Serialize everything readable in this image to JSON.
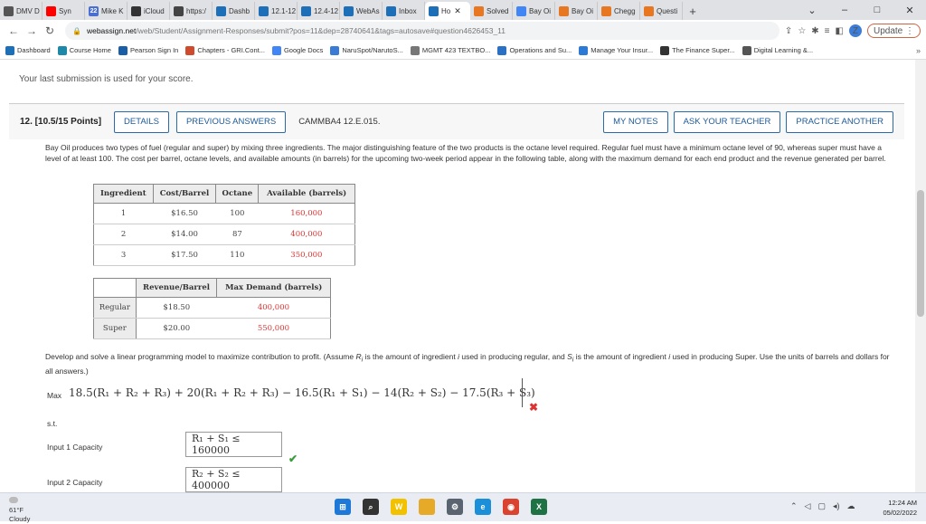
{
  "browser": {
    "tabs": [
      {
        "label": "DMV D",
        "icon": "chrome-icon",
        "color": "#555555"
      },
      {
        "label": "Syn",
        "icon": "youtube-icon",
        "color": "#ff0000"
      },
      {
        "label": "Mike K",
        "icon": "twenty-two-icon",
        "color": "#4a6fd1",
        "icon_text": "22"
      },
      {
        "label": "iCloud",
        "icon": "apple-icon",
        "color": "#333333"
      },
      {
        "label": "https:/",
        "icon": "doc-icon",
        "color": "#444444"
      },
      {
        "label": "Dashb",
        "icon": "webassign-icon",
        "color": "#1d6fb8"
      },
      {
        "label": "12.1-12",
        "icon": "webassign-icon",
        "color": "#1d6fb8"
      },
      {
        "label": "12.4-12",
        "icon": "webassign-icon",
        "color": "#1d6fb8"
      },
      {
        "label": "WebAs",
        "icon": "webassign-icon",
        "color": "#1d6fb8"
      },
      {
        "label": "Inbox",
        "icon": "webassign-icon",
        "color": "#1d6fb8"
      },
      {
        "label": "Ho",
        "icon": "webassign-icon",
        "color": "#1d6fb8",
        "active": true
      },
      {
        "label": "Solved",
        "icon": "chegg-icon",
        "color": "#e87722"
      },
      {
        "label": "Bay Oi",
        "icon": "google-icon",
        "color": "#4285f4"
      },
      {
        "label": "Bay Oi",
        "icon": "chegg-icon",
        "color": "#e87722"
      },
      {
        "label": "Chegg",
        "icon": "chegg-icon",
        "color": "#e87722"
      },
      {
        "label": "Questi",
        "icon": "chegg-icon",
        "color": "#e87722"
      }
    ],
    "new_tab": "+",
    "window_controls": {
      "minimize": "–",
      "maximize": "□",
      "close": "✕"
    },
    "url_host": "webassign.net",
    "url_path": "/web/Student/Assignment-Responses/submit?pos=11&dep=28740641&tags=autosave#question4626453_11",
    "avatar_letter": "Z",
    "update_label": "Update",
    "bookmarks": [
      {
        "label": "Dashboard",
        "icon": "webassign-icon",
        "color": "#1d6fb8"
      },
      {
        "label": "Course Home",
        "icon": "course-icon",
        "color": "#1e88a8"
      },
      {
        "label": "Pearson Sign In",
        "icon": "pearson-icon",
        "color": "#1a5ea8"
      },
      {
        "label": "Chapters - GRI.Cont...",
        "icon": "chapters-icon",
        "color": "#d04a2e"
      },
      {
        "label": "Google Docs",
        "icon": "docs-icon",
        "color": "#4285f4"
      },
      {
        "label": "NaruSpot/NarutoS...",
        "icon": "naru-icon",
        "color": "#3a7bd5"
      },
      {
        "label": "MGMT 423 TEXTBO...",
        "icon": "globe-icon",
        "color": "#777777"
      },
      {
        "label": "Operations and Su...",
        "icon": "book-icon",
        "color": "#2a70c4"
      },
      {
        "label": "Manage Your Insur...",
        "icon": "insurance-icon",
        "color": "#2c7ad6"
      },
      {
        "label": "The Finance Super...",
        "icon": "finance-icon",
        "color": "#333333"
      },
      {
        "label": "Digital Learning &...",
        "icon": "learning-icon",
        "color": "#555555"
      }
    ]
  },
  "page": {
    "submission_note": "Your last submission is used for your score.",
    "question_number": "12.  [10.5/15 Points]",
    "details_button": "DETAILS",
    "previous_answers_button": "PREVIOUS ANSWERS",
    "question_code": "CAMMBA4 12.E.015.",
    "my_notes_button": "MY NOTES",
    "ask_teacher_button": "ASK YOUR TEACHER",
    "practice_button": "PRACTICE ANOTHER",
    "problem_text": "Bay Oil produces two types of fuel (regular and super) by mixing three ingredients. The major distinguishing feature of the two products is the octane level required. Regular fuel must have a minimum octane level of 90, whereas super must have a level of at least 100. The cost per barrel, octane levels, and available amounts (in barrels) for the upcoming two-week period appear in the following table, along with the maximum demand for each end product and the revenue generated per barrel.",
    "ingredient_table": {
      "headers": [
        "Ingredient",
        "Cost/Barrel",
        "Octane",
        "Available (barrels)"
      ],
      "rows": [
        [
          "1",
          "$16.50",
          "100",
          "160,000"
        ],
        [
          "2",
          "$14.00",
          "87",
          "400,000"
        ],
        [
          "3",
          "$17.50",
          "110",
          "350,000"
        ]
      ]
    },
    "product_table": {
      "headers": [
        "",
        "Revenue/Barrel",
        "Max Demand (barrels)"
      ],
      "rows": [
        [
          "Regular",
          "$18.50",
          "400,000"
        ],
        [
          "Super",
          "$20.00",
          "550,000"
        ]
      ]
    },
    "instructions_a": "Develop and solve a linear programming model to maximize contribution to profit. (Assume ",
    "instructions_b": " is the amount of ingredient ",
    "instructions_c": " used in producing regular, and ",
    "instructions_d": " is the amount of ingredient ",
    "instructions_e": " used in producing Super. Use the units of barrels and dollars for all answers.)",
    "sym_R": "R",
    "sym_S": "S",
    "sym_i": "i",
    "sym_i2": "i",
    "max_label": "Max",
    "objective_expression": "18.5(R₁ + R₂ + R₃) + 20(R₁ + R₂ + R₃) − 16.5(R₁ + S₁) − 14(R₂ + S₂) − 17.5(R₃ + S₃)",
    "objective_wrong_mark": "✖",
    "st_label": "s.t.",
    "constraints": [
      {
        "label": "Input 1 Capacity",
        "expression": "R₁ + S₁ ≤ 160000",
        "mark": "✔"
      },
      {
        "label": "Input 2 Capacity",
        "expression": "R₂ + S₂ ≤ 400000",
        "mark": ""
      }
    ]
  },
  "taskbar": {
    "temperature": "61°F",
    "condition": "Cloudy",
    "apps": [
      {
        "name": "windows-start-icon",
        "color": "#1e78d7",
        "text": "⊞"
      },
      {
        "name": "search-icon",
        "color": "#333333",
        "text": "⌕"
      },
      {
        "name": "norton-icon",
        "color": "#f2c100",
        "text": "W"
      },
      {
        "name": "folder-icon",
        "color": "#e7a928",
        "text": ""
      },
      {
        "name": "settings-icon",
        "color": "#5a6470",
        "text": "⚙"
      },
      {
        "name": "edge-icon",
        "color": "#1b8fd8",
        "text": "e"
      },
      {
        "name": "chrome-icon",
        "color": "#d9432f",
        "text": "◉"
      },
      {
        "name": "excel-icon",
        "color": "#1f7244",
        "text": "X"
      }
    ],
    "time": "12:24 AM",
    "date": "05/02/2022"
  }
}
